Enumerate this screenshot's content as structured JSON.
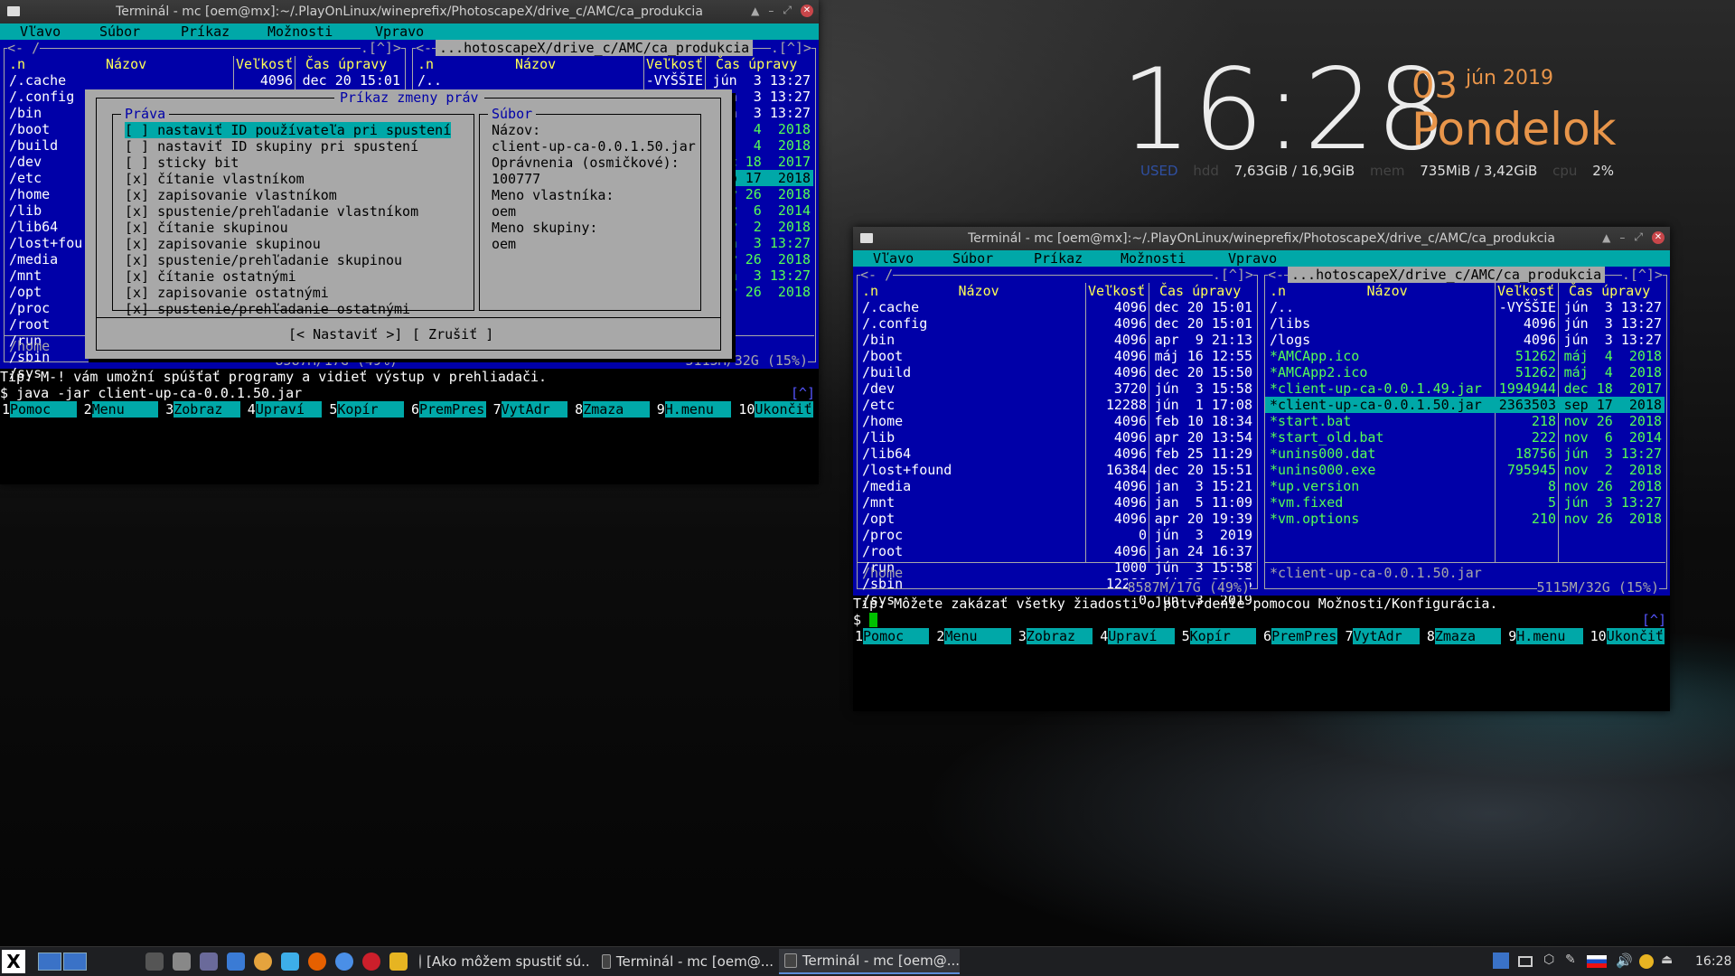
{
  "conky": {
    "time": "16:28",
    "day": "03",
    "month_year": "jún 2019",
    "weekday": "Pondelok",
    "used_label": "USED",
    "hdd_label": "hdd",
    "hdd_value": "7,63GiB / 16,9GiB",
    "mem_label": "mem",
    "mem_value": "735MiB / 3,42GiB",
    "cpu_label": "cpu",
    "cpu_value": "2%"
  },
  "window1": {
    "title": "Terminál - mc [oem@mx]:~/.PlayOnLinux/wineprefix/PhotoscapeX/drive_c/AMC/ca_produkcia",
    "menu": [
      "Vľavo",
      "Súbor",
      "Príkaz",
      "Možnosti",
      "Vpravo"
    ],
    "left_top": "<- /",
    "left_up": ".[^]>",
    "right_path": "...hotoscapeX/drive_c/AMC/ca_produkcia",
    "right_up": ".[^]>",
    "col_n": ".n",
    "col_name": "Názov",
    "col_size": "Veľkosť",
    "col_time": "Čas úpravy",
    "left_rows": [
      {
        "name": "/.cache",
        "size": "4096",
        "time": "dec 20 15:01"
      },
      {
        "name": "/.config",
        "size": "",
        "time": ""
      },
      {
        "name": "/bin",
        "size": "",
        "time": ""
      },
      {
        "name": "/boot",
        "size": "",
        "time": ""
      },
      {
        "name": "/build",
        "size": "",
        "time": ""
      },
      {
        "name": "/dev",
        "size": "",
        "time": ""
      },
      {
        "name": "/etc",
        "size": "",
        "time": ""
      },
      {
        "name": "/home",
        "size": "",
        "time": ""
      },
      {
        "name": "/lib",
        "size": "",
        "time": ""
      },
      {
        "name": "/lib64",
        "size": "",
        "time": ""
      },
      {
        "name": "/lost+fou",
        "size": "",
        "time": ""
      },
      {
        "name": "/media",
        "size": "",
        "time": ""
      },
      {
        "name": "/mnt",
        "size": "",
        "time": ""
      },
      {
        "name": "/opt",
        "size": "",
        "time": ""
      },
      {
        "name": "/proc",
        "size": "",
        "time": ""
      },
      {
        "name": "/root",
        "size": "",
        "time": ""
      },
      {
        "name": "/run",
        "size": "",
        "time": ""
      },
      {
        "name": "/sbin",
        "size": "",
        "time": ""
      },
      {
        "name": "/sys",
        "size": "",
        "time": ""
      }
    ],
    "right_rows": [
      {
        "name": "/..",
        "size": "-VYŠŠIE",
        "time": "jún  3 13:27",
        "exec": false,
        "sel": false
      },
      {
        "name": "",
        "size": "",
        "time": "n  3 13:27",
        "exec": false,
        "sel": false
      },
      {
        "name": "",
        "size": "",
        "time": "n  3 13:27",
        "exec": false,
        "sel": false
      },
      {
        "name": "",
        "size": "",
        "time": "j  4  2018",
        "exec": true,
        "sel": false
      },
      {
        "name": "",
        "size": "",
        "time": "j  4  2018",
        "exec": true,
        "sel": false
      },
      {
        "name": "",
        "size": "",
        "time": "c 18  2017",
        "exec": true,
        "sel": false
      },
      {
        "name": "",
        "size": "",
        "time": "p 17  2018",
        "exec": false,
        "sel": true
      },
      {
        "name": "",
        "size": "",
        "time": "v 26  2018",
        "exec": true,
        "sel": false
      },
      {
        "name": "",
        "size": "",
        "time": "v  6  2014",
        "exec": true,
        "sel": false
      },
      {
        "name": "",
        "size": "",
        "time": "v  2  2018",
        "exec": true,
        "sel": false
      },
      {
        "name": "",
        "size": "",
        "time": "n  3 13:27",
        "exec": true,
        "sel": false
      },
      {
        "name": "",
        "size": "",
        "time": "v 26  2018",
        "exec": true,
        "sel": false
      },
      {
        "name": "",
        "size": "",
        "time": "n  3 13:27",
        "exec": true,
        "sel": false
      },
      {
        "name": "",
        "size": "",
        "time": "v 26  2018",
        "exec": true,
        "sel": false
      }
    ],
    "left_status": "/home",
    "left_free": "8587M/17G (49%)",
    "right_free": "5115M/32G (15%)",
    "tip": "Tip: M-! vám umožní spúšťať programy a vidieť výstup v prehliadači.",
    "prompt": "$ java -jar client-up-ca-0.0.1.50.jar",
    "up_marker": "[^]",
    "dialog": {
      "title": "Príkaz zmeny práv",
      "rights_label": "Práva",
      "file_label": "Súbor",
      "items": [
        {
          "check": "[ ]",
          "text": "nastaviť ID používateľa pri spustení",
          "sel": true
        },
        {
          "check": "[ ]",
          "text": "nastaviť ID skupiny pri spustení",
          "sel": false
        },
        {
          "check": "[ ]",
          "text": "sticky bit",
          "sel": false
        },
        {
          "check": "[x]",
          "text": "čítanie vlastníkom",
          "sel": false
        },
        {
          "check": "[x]",
          "text": "zapisovanie vlastníkom",
          "sel": false
        },
        {
          "check": "[x]",
          "text": "spustenie/prehľadanie vlastníkom",
          "sel": false
        },
        {
          "check": "[x]",
          "text": "čítanie skupinou",
          "sel": false
        },
        {
          "check": "[x]",
          "text": "zapisovanie skupinou",
          "sel": false
        },
        {
          "check": "[x]",
          "text": "spustenie/prehľadanie skupinou",
          "sel": false
        },
        {
          "check": "[x]",
          "text": "čítanie ostatnými",
          "sel": false
        },
        {
          "check": "[x]",
          "text": "zapisovanie ostatnými",
          "sel": false
        },
        {
          "check": "[x]",
          "text": "spustenie/prehľadanie ostatnými",
          "sel": false
        }
      ],
      "file_info": [
        "Názov:",
        "client-up-ca-0.0.1.50.jar",
        "Oprávnenia (osmičkové):",
        "100777",
        "Meno vlastníka:",
        "oem",
        "Meno skupiny:",
        "oem"
      ],
      "set_button": "[< Nastaviť >]",
      "cancel_button": "[ Zrušiť ]"
    }
  },
  "window2": {
    "title": "Terminál - mc [oem@mx]:~/.PlayOnLinux/wineprefix/PhotoscapeX/drive_c/AMC/ca_produkcia",
    "menu": [
      "Vľavo",
      "Súbor",
      "Príkaz",
      "Možnosti",
      "Vpravo"
    ],
    "left_top": "<- /",
    "left_up": ".[^]>",
    "right_path": "...hotoscapeX/drive_c/AMC/ca_produkcia",
    "right_up": ".[^]>",
    "col_n": ".n",
    "col_name": "Názov",
    "col_size": "Veľkosť",
    "col_time": "Čas úpravy",
    "left_rows": [
      {
        "name": "/.cache",
        "size": "4096",
        "time": "dec 20 15:01"
      },
      {
        "name": "/.config",
        "size": "4096",
        "time": "dec 20 15:01"
      },
      {
        "name": "/bin",
        "size": "4096",
        "time": "apr  9 21:13"
      },
      {
        "name": "/boot",
        "size": "4096",
        "time": "máj 16 12:55"
      },
      {
        "name": "/build",
        "size": "4096",
        "time": "dec 20 15:50"
      },
      {
        "name": "/dev",
        "size": "3720",
        "time": "jún  3 15:58"
      },
      {
        "name": "/etc",
        "size": "12288",
        "time": "jún  1 17:08"
      },
      {
        "name": "/home",
        "size": "4096",
        "time": "feb 10 18:34"
      },
      {
        "name": "/lib",
        "size": "4096",
        "time": "apr 20 13:54"
      },
      {
        "name": "/lib64",
        "size": "4096",
        "time": "feb 25 11:29"
      },
      {
        "name": "/lost+found",
        "size": "16384",
        "time": "dec 20 15:51"
      },
      {
        "name": "/media",
        "size": "4096",
        "time": "jan  3 15:21"
      },
      {
        "name": "/mnt",
        "size": "4096",
        "time": "jan  5 11:09"
      },
      {
        "name": "/opt",
        "size": "4096",
        "time": "apr 20 19:39"
      },
      {
        "name": "/proc",
        "size": "0",
        "time": "jún  3  2019"
      },
      {
        "name": "/root",
        "size": "4096",
        "time": "jan 24 16:37"
      },
      {
        "name": "/run",
        "size": "1000",
        "time": "jún  3 15:58"
      },
      {
        "name": "/sbin",
        "size": "12288",
        "time": "máj 25 21:05"
      },
      {
        "name": "/sys",
        "size": "0",
        "time": "jún  3  2019"
      }
    ],
    "right_rows": [
      {
        "name": "/..",
        "size": "-VYŠŠIE",
        "time": "jún  3 13:27",
        "exec": false,
        "sel": false
      },
      {
        "name": "/libs",
        "size": "4096",
        "time": "jún  3 13:27",
        "exec": false,
        "sel": false
      },
      {
        "name": "/logs",
        "size": "4096",
        "time": "jún  3 13:27",
        "exec": false,
        "sel": false
      },
      {
        "name": "*AMCApp.ico",
        "size": "51262",
        "time": "máj  4  2018",
        "exec": true,
        "sel": false
      },
      {
        "name": "*AMCApp2.ico",
        "size": "51262",
        "time": "máj  4  2018",
        "exec": true,
        "sel": false
      },
      {
        "name": "*client-up-ca-0.0.1.49.jar",
        "size": "1994944",
        "time": "dec 18  2017",
        "exec": true,
        "sel": false
      },
      {
        "name": "*client-up-ca-0.0.1.50.jar",
        "size": "2363503",
        "time": "sep 17  2018",
        "exec": false,
        "sel": true
      },
      {
        "name": "*start.bat",
        "size": "218",
        "time": "nov 26  2018",
        "exec": true,
        "sel": false
      },
      {
        "name": "*start_old.bat",
        "size": "222",
        "time": "nov  6  2014",
        "exec": true,
        "sel": false
      },
      {
        "name": "*unins000.dat",
        "size": "18756",
        "time": "jún  3 13:27",
        "exec": true,
        "sel": false
      },
      {
        "name": "*unins000.exe",
        "size": "795945",
        "time": "nov  2  2018",
        "exec": true,
        "sel": false
      },
      {
        "name": "*up.version",
        "size": "8",
        "time": "nov 26  2018",
        "exec": true,
        "sel": false
      },
      {
        "name": "*vm.fixed",
        "size": "5",
        "time": "jún  3 13:27",
        "exec": true,
        "sel": false
      },
      {
        "name": "*vm.options",
        "size": "210",
        "time": "nov 26  2018",
        "exec": true,
        "sel": false
      }
    ],
    "left_status": "/home",
    "right_status": "*client-up-ca-0.0.1.50.jar",
    "left_free": "8587M/17G (49%)",
    "right_free": "5115M/32G (15%)",
    "tip": "Tip: Môžete zakázať všetky žiadosti o potvrdenie pomocou Možnosti/Konfigurácia.",
    "prompt": "$ ",
    "up_marker": "[^]"
  },
  "fkeys": [
    {
      "n": "1",
      "label": "Pomoc"
    },
    {
      "n": "2",
      "label": "Menu"
    },
    {
      "n": "3",
      "label": "Zobraz"
    },
    {
      "n": "4",
      "label": "Upraví"
    },
    {
      "n": "5",
      "label": "Kopír"
    },
    {
      "n": "6",
      "label": "PremPres"
    },
    {
      "n": "7",
      "label": "VytAdr"
    },
    {
      "n": "8",
      "label": "Zmaza"
    },
    {
      "n": "9",
      "label": "H.menu"
    },
    {
      "n": "10",
      "label": "Ukončiť"
    }
  ],
  "taskbar": {
    "tasks": [
      {
        "label": "[Ako môžem spustiť sú...",
        "icon_color": "#d33"
      },
      {
        "label": "Terminál - mc [oem@...",
        "icon_color": "#444"
      },
      {
        "label": "Terminál - mc [oem@...",
        "icon_color": "#444"
      }
    ],
    "clock": "16:28",
    "launchers": [
      {
        "icon": "terminal-icon",
        "color": "#555"
      },
      {
        "icon": "file-manager-icon",
        "color": "#888"
      },
      {
        "icon": "archive-icon",
        "color": "#6a6a9a"
      },
      {
        "icon": "document-icon",
        "color": "#3a7bd5"
      },
      {
        "icon": "browser-icon",
        "color": "#e5a33d"
      },
      {
        "icon": "kde-icon",
        "color": "#3daee9"
      },
      {
        "icon": "firefox-icon",
        "color": "#e66000"
      },
      {
        "icon": "chromium-icon",
        "color": "#4a8fe7"
      },
      {
        "icon": "opera-icon",
        "color": "#cc1f2b"
      },
      {
        "icon": "puzzle-icon",
        "color": "#e6b422"
      }
    ]
  }
}
